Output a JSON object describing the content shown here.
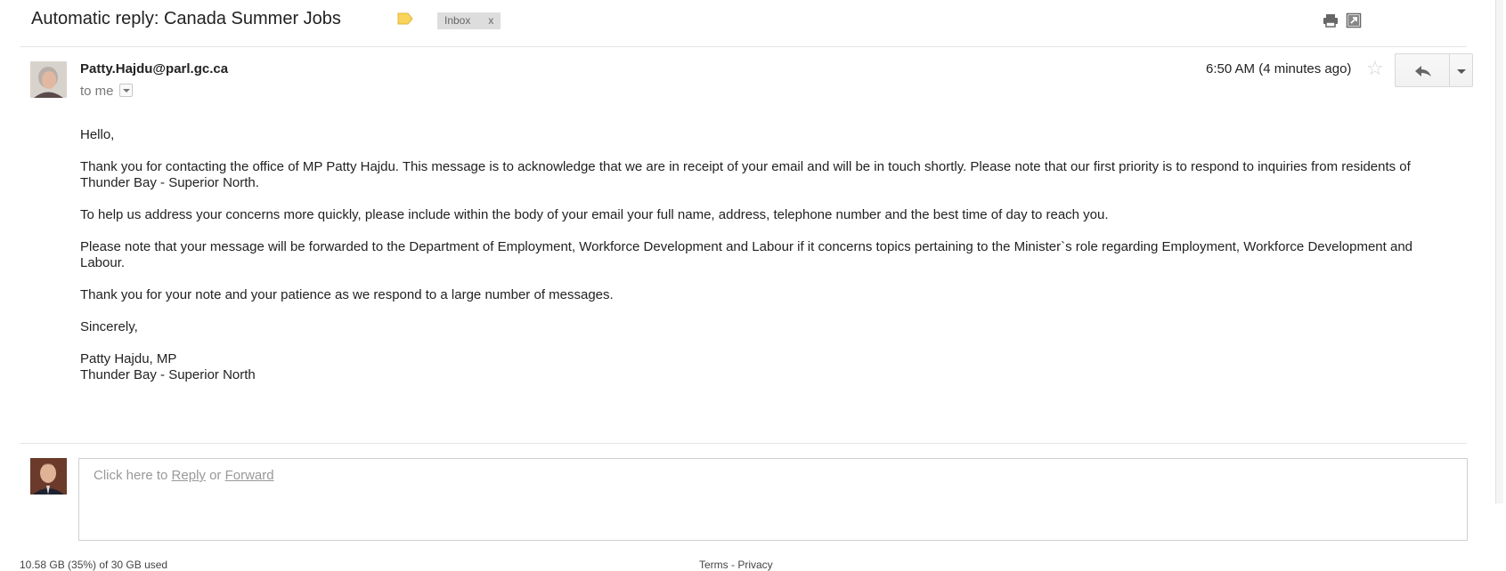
{
  "header": {
    "subject": "Automatic reply: Canada Summer Jobs",
    "label_chip": "Inbox",
    "label_chip_remove": "x",
    "label_color": "#f8d45c"
  },
  "message": {
    "from": "Patty.Hajdu@parl.gc.ca",
    "to": "to me",
    "date": "6:50 AM (4 minutes ago)",
    "body": [
      "Hello,",
      "Thank you for contacting the office of MP Patty Hajdu. This message is to acknowledge that we are in receipt of your email and will be in touch shortly. Please note that our first priority is to respond to inquiries from residents of Thunder Bay - Superior North.",
      "To help us address your concerns more quickly, please include within the body of your email your full name, address, telephone number and the best time of day to reach you.",
      "Please note that your message will be forwarded to the Department of Employment, Workforce Development and Labour if it concerns topics pertaining to the Minister`s role regarding Employment, Workforce Development and Labour.",
      "Thank you for your note and your patience as we respond to a large number of messages.",
      "Sincerely,"
    ],
    "signature": [
      "Patty Hajdu, MP",
      "Thunder Bay - Superior North"
    ]
  },
  "reply_box": {
    "prefix": "Click here to ",
    "reply": "Reply",
    "or": " or ",
    "forward": "Forward"
  },
  "footer": {
    "left": "10.58 GB (35%) of 30 GB used",
    "center": "Terms - Privacy"
  },
  "icons": {
    "print": "print-icon",
    "new_window": "open-in-new-window-icon",
    "star": "star-icon",
    "reply": "reply-arrow-icon",
    "more": "chevron-down-icon",
    "label": "label-tag-icon"
  }
}
